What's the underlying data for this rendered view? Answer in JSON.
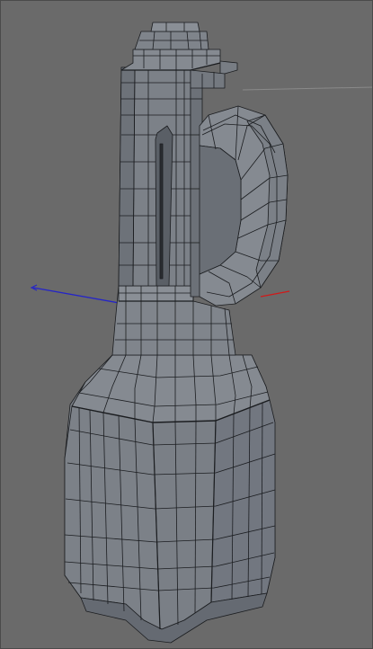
{
  "viewport": {
    "background": "#6a6a6a",
    "border_color": "#4a4a4a"
  },
  "scene": {
    "object": "blender-mesh",
    "display_mode": "shaded-wireframe",
    "surface_color": "#7a7f86",
    "wire_color": "#1b1d20",
    "shadow_color": "#565b61",
    "highlight_color": "#8e939a"
  },
  "axes": {
    "x_color": "#d01a1a",
    "z_color": "#2424c8",
    "horizon_color": "#8a8a8a"
  }
}
